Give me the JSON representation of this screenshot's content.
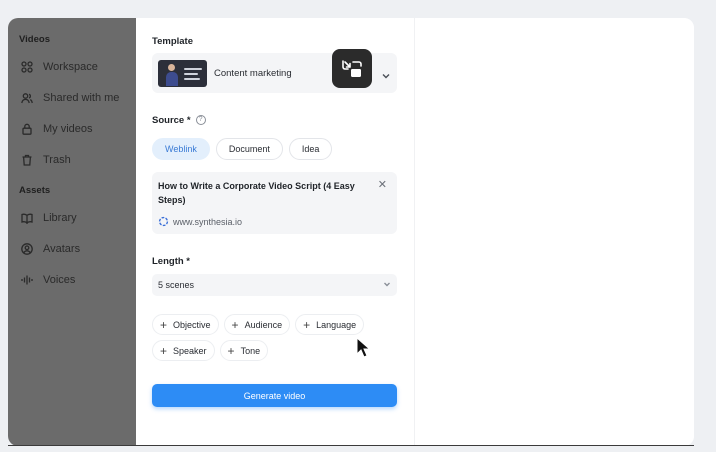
{
  "sidebar": {
    "sections": [
      {
        "title": "Videos",
        "items": [
          {
            "label": "Workspace",
            "icon": "workspace-icon"
          },
          {
            "label": "Shared with me",
            "icon": "users-icon"
          },
          {
            "label": "My videos",
            "icon": "lock-icon"
          },
          {
            "label": "Trash",
            "icon": "trash-icon"
          }
        ]
      },
      {
        "title": "Assets",
        "items": [
          {
            "label": "Library",
            "icon": "book-icon"
          },
          {
            "label": "Avatars",
            "icon": "avatar-icon"
          },
          {
            "label": "Voices",
            "icon": "waveform-icon"
          }
        ]
      }
    ]
  },
  "form": {
    "template_label": "Template",
    "template_name": "Content marketing",
    "source_label": "Source *",
    "source_tabs": [
      "Weblink",
      "Document",
      "Idea"
    ],
    "source_active": "Weblink",
    "source_title": "How to Write a Corporate Video Script (4 Easy Steps)",
    "source_site": "www.synthesia.io",
    "length_label": "Length *",
    "length_value": "5 scenes",
    "add_options": [
      "Objective",
      "Audience",
      "Language",
      "Speaker",
      "Tone"
    ],
    "generate_label": "Generate video"
  },
  "colors": {
    "accent": "#2d8cf5",
    "active_chip_bg": "#e3effc",
    "sidebar_overlay": "#6b6b6b"
  }
}
